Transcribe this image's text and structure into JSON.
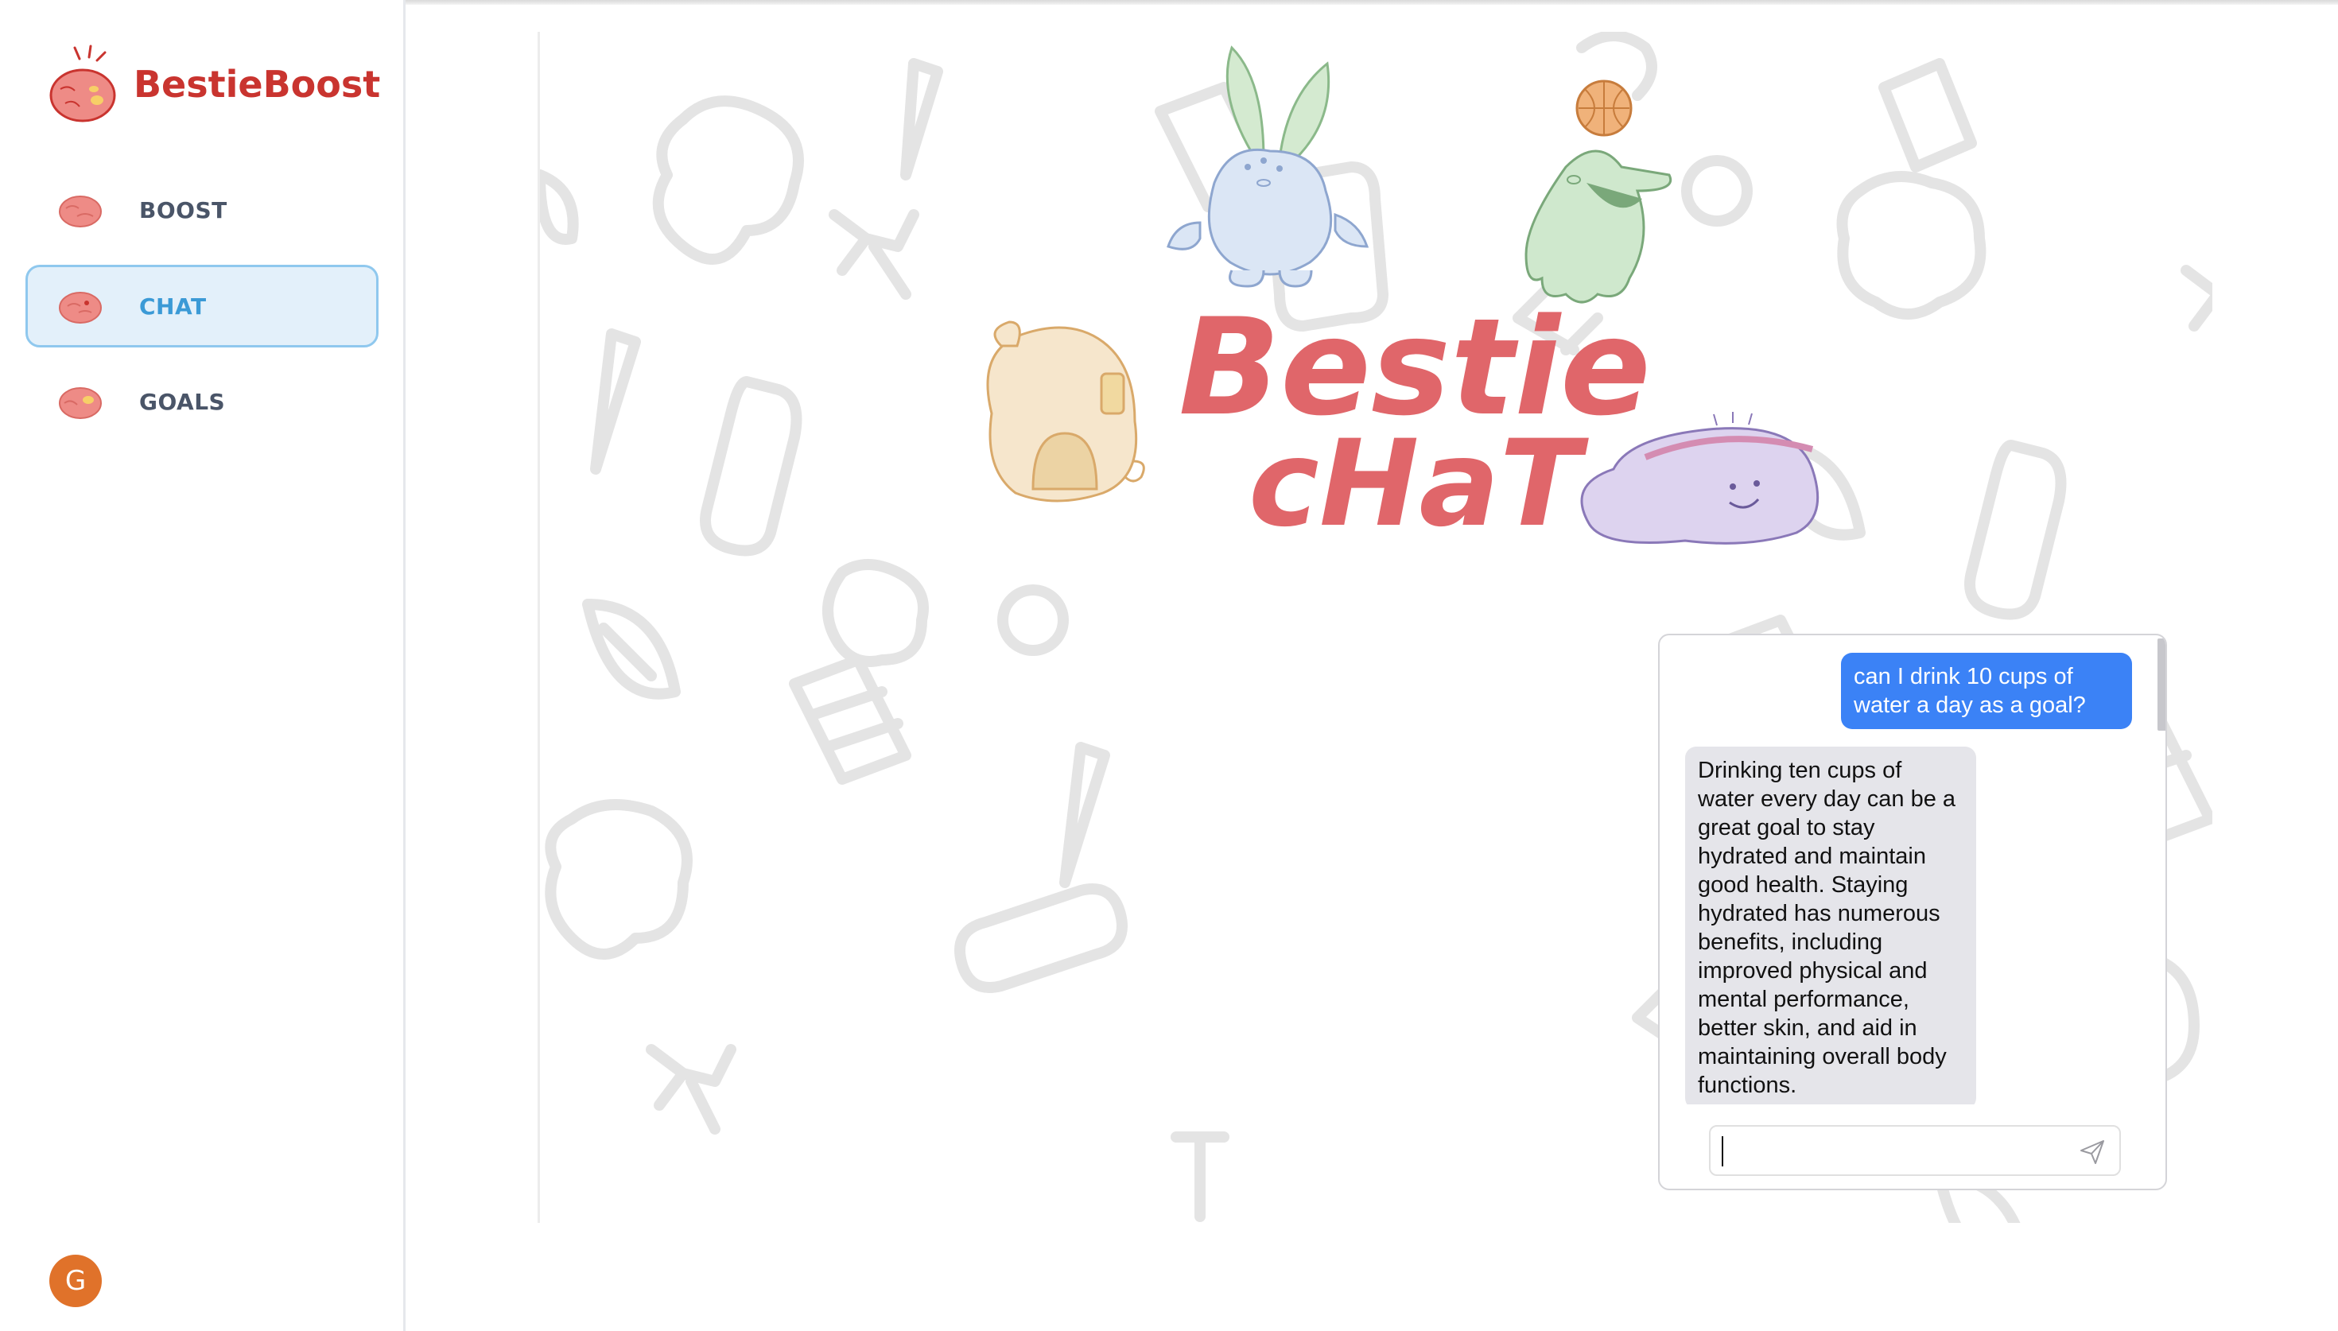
{
  "app": {
    "name": "BestieBoost"
  },
  "sidebar": {
    "items": [
      {
        "label": "BOOST",
        "active": false
      },
      {
        "label": "CHAT",
        "active": true
      },
      {
        "label": "GOALS",
        "active": false
      }
    ],
    "avatar_initial": "G"
  },
  "hero": {
    "title_line1": "Bestie",
    "title_line2": "cHaT"
  },
  "chat": {
    "messages": [
      {
        "role": "user",
        "text": "can I drink 10 cups of water a day as a goal?"
      },
      {
        "role": "assistant",
        "text": "Drinking ten cups of water every day can be a great goal to stay hydrated and maintain good health. Staying hydrated has numerous benefits, including improved physical and mental performance, better skin, and aid in maintaining overall body functions."
      }
    ],
    "input": {
      "value": "",
      "placeholder": ""
    }
  },
  "colors": {
    "brand": "#c9342f",
    "active_nav_bg": "#e3f0fa",
    "active_nav_border": "#8fc8ee",
    "user_bubble": "#3b82f6",
    "bot_bubble": "#e5e5ea",
    "avatar": "#e0722a"
  }
}
